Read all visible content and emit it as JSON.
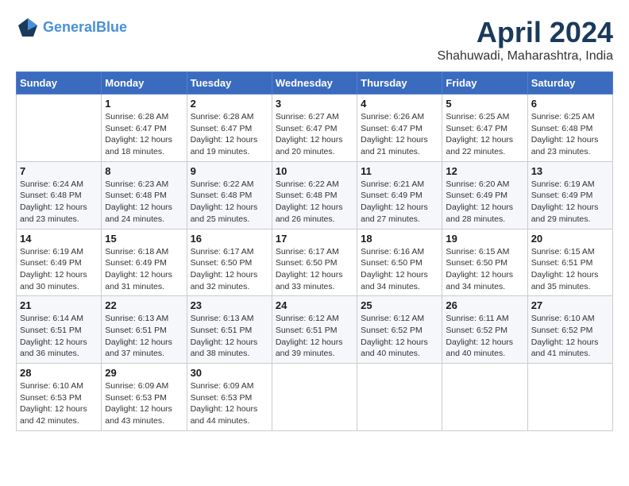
{
  "header": {
    "logo_line1": "General",
    "logo_line2": "Blue",
    "month_title": "April 2024",
    "location": "Shahuwadi, Maharashtra, India"
  },
  "weekdays": [
    "Sunday",
    "Monday",
    "Tuesday",
    "Wednesday",
    "Thursday",
    "Friday",
    "Saturday"
  ],
  "weeks": [
    [
      {
        "day": "",
        "info": ""
      },
      {
        "day": "1",
        "info": "Sunrise: 6:28 AM\nSunset: 6:47 PM\nDaylight: 12 hours\nand 18 minutes."
      },
      {
        "day": "2",
        "info": "Sunrise: 6:28 AM\nSunset: 6:47 PM\nDaylight: 12 hours\nand 19 minutes."
      },
      {
        "day": "3",
        "info": "Sunrise: 6:27 AM\nSunset: 6:47 PM\nDaylight: 12 hours\nand 20 minutes."
      },
      {
        "day": "4",
        "info": "Sunrise: 6:26 AM\nSunset: 6:47 PM\nDaylight: 12 hours\nand 21 minutes."
      },
      {
        "day": "5",
        "info": "Sunrise: 6:25 AM\nSunset: 6:47 PM\nDaylight: 12 hours\nand 22 minutes."
      },
      {
        "day": "6",
        "info": "Sunrise: 6:25 AM\nSunset: 6:48 PM\nDaylight: 12 hours\nand 23 minutes."
      }
    ],
    [
      {
        "day": "7",
        "info": "Sunrise: 6:24 AM\nSunset: 6:48 PM\nDaylight: 12 hours\nand 23 minutes."
      },
      {
        "day": "8",
        "info": "Sunrise: 6:23 AM\nSunset: 6:48 PM\nDaylight: 12 hours\nand 24 minutes."
      },
      {
        "day": "9",
        "info": "Sunrise: 6:22 AM\nSunset: 6:48 PM\nDaylight: 12 hours\nand 25 minutes."
      },
      {
        "day": "10",
        "info": "Sunrise: 6:22 AM\nSunset: 6:48 PM\nDaylight: 12 hours\nand 26 minutes."
      },
      {
        "day": "11",
        "info": "Sunrise: 6:21 AM\nSunset: 6:49 PM\nDaylight: 12 hours\nand 27 minutes."
      },
      {
        "day": "12",
        "info": "Sunrise: 6:20 AM\nSunset: 6:49 PM\nDaylight: 12 hours\nand 28 minutes."
      },
      {
        "day": "13",
        "info": "Sunrise: 6:19 AM\nSunset: 6:49 PM\nDaylight: 12 hours\nand 29 minutes."
      }
    ],
    [
      {
        "day": "14",
        "info": "Sunrise: 6:19 AM\nSunset: 6:49 PM\nDaylight: 12 hours\nand 30 minutes."
      },
      {
        "day": "15",
        "info": "Sunrise: 6:18 AM\nSunset: 6:49 PM\nDaylight: 12 hours\nand 31 minutes."
      },
      {
        "day": "16",
        "info": "Sunrise: 6:17 AM\nSunset: 6:50 PM\nDaylight: 12 hours\nand 32 minutes."
      },
      {
        "day": "17",
        "info": "Sunrise: 6:17 AM\nSunset: 6:50 PM\nDaylight: 12 hours\nand 33 minutes."
      },
      {
        "day": "18",
        "info": "Sunrise: 6:16 AM\nSunset: 6:50 PM\nDaylight: 12 hours\nand 34 minutes."
      },
      {
        "day": "19",
        "info": "Sunrise: 6:15 AM\nSunset: 6:50 PM\nDaylight: 12 hours\nand 34 minutes."
      },
      {
        "day": "20",
        "info": "Sunrise: 6:15 AM\nSunset: 6:51 PM\nDaylight: 12 hours\nand 35 minutes."
      }
    ],
    [
      {
        "day": "21",
        "info": "Sunrise: 6:14 AM\nSunset: 6:51 PM\nDaylight: 12 hours\nand 36 minutes."
      },
      {
        "day": "22",
        "info": "Sunrise: 6:13 AM\nSunset: 6:51 PM\nDaylight: 12 hours\nand 37 minutes."
      },
      {
        "day": "23",
        "info": "Sunrise: 6:13 AM\nSunset: 6:51 PM\nDaylight: 12 hours\nand 38 minutes."
      },
      {
        "day": "24",
        "info": "Sunrise: 6:12 AM\nSunset: 6:51 PM\nDaylight: 12 hours\nand 39 minutes."
      },
      {
        "day": "25",
        "info": "Sunrise: 6:12 AM\nSunset: 6:52 PM\nDaylight: 12 hours\nand 40 minutes."
      },
      {
        "day": "26",
        "info": "Sunrise: 6:11 AM\nSunset: 6:52 PM\nDaylight: 12 hours\nand 40 minutes."
      },
      {
        "day": "27",
        "info": "Sunrise: 6:10 AM\nSunset: 6:52 PM\nDaylight: 12 hours\nand 41 minutes."
      }
    ],
    [
      {
        "day": "28",
        "info": "Sunrise: 6:10 AM\nSunset: 6:53 PM\nDaylight: 12 hours\nand 42 minutes."
      },
      {
        "day": "29",
        "info": "Sunrise: 6:09 AM\nSunset: 6:53 PM\nDaylight: 12 hours\nand 43 minutes."
      },
      {
        "day": "30",
        "info": "Sunrise: 6:09 AM\nSunset: 6:53 PM\nDaylight: 12 hours\nand 44 minutes."
      },
      {
        "day": "",
        "info": ""
      },
      {
        "day": "",
        "info": ""
      },
      {
        "day": "",
        "info": ""
      },
      {
        "day": "",
        "info": ""
      }
    ]
  ]
}
